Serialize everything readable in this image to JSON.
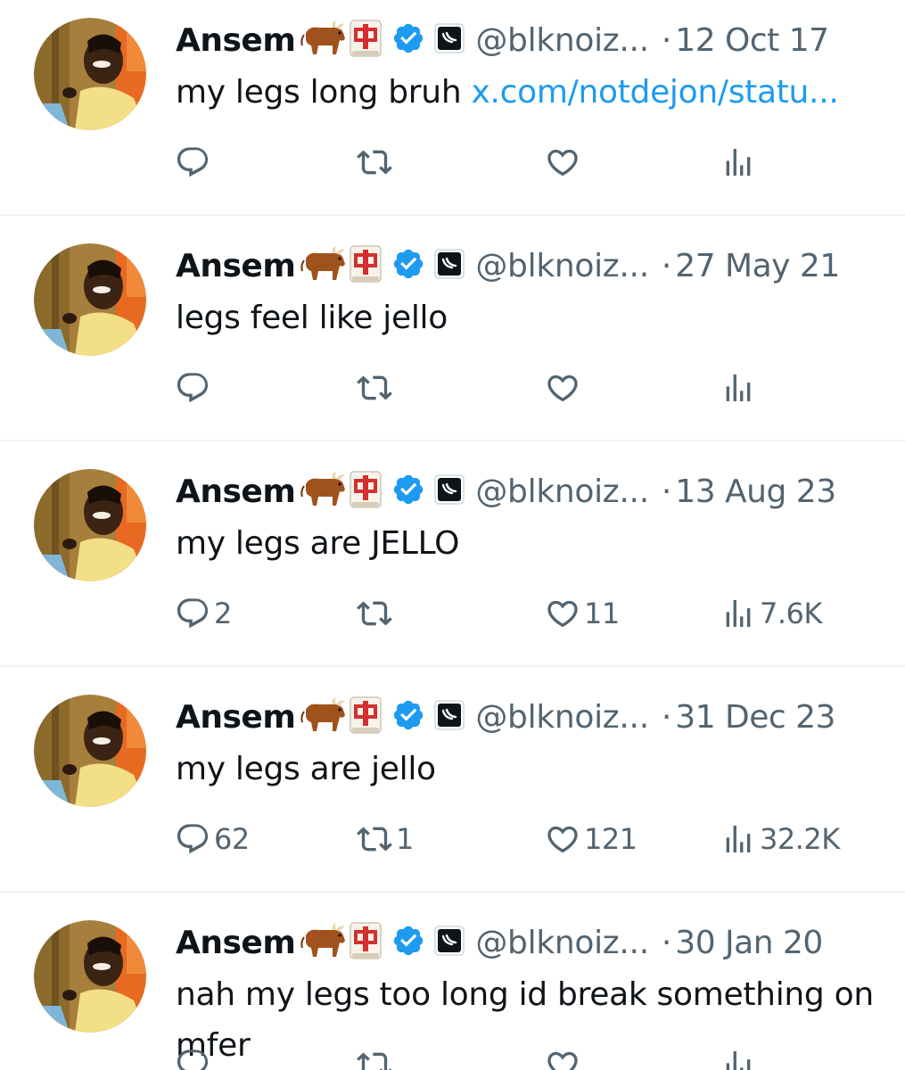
{
  "tweets": [
    {
      "name": "Ansem",
      "handle": "@blknoiz...",
      "dot": "·",
      "date": "12 Oct 17",
      "text": "my legs long bruh ",
      "link": "x.com/notdejon/statu...",
      "text2": "",
      "replies": "",
      "retweets": "",
      "likes": "",
      "views": ""
    },
    {
      "name": "Ansem",
      "handle": "@blknoiz...",
      "dot": "·",
      "date": "27 May 21",
      "text": "legs feel like jello",
      "link": "",
      "text2": "",
      "replies": "",
      "retweets": "",
      "likes": "",
      "views": ""
    },
    {
      "name": "Ansem",
      "handle": "@blknoiz...",
      "dot": "·",
      "date": "13 Aug 23",
      "text": "my legs are JELLO",
      "link": "",
      "text2": "",
      "replies": "2",
      "retweets": "",
      "likes": "11",
      "views": "7.6K"
    },
    {
      "name": "Ansem",
      "handle": "@blknoiz...",
      "dot": "·",
      "date": "31 Dec 23",
      "text": "my legs are jello",
      "link": "",
      "text2": "",
      "replies": "62",
      "retweets": "1",
      "likes": "121",
      "views": "32.2K"
    },
    {
      "name": "Ansem",
      "handle": "@blknoiz...",
      "dot": "·",
      "date": "30 Jan 20",
      "text": "nah my legs too long id break something on",
      "link": "",
      "text2": "mfer",
      "replies": "",
      "retweets": "",
      "likes": "",
      "views": ""
    }
  ],
  "icons": {
    "emoji1": "ox-emoji",
    "emoji2": "mahjong-red-dragon-emoji",
    "verified": "verified-badge-icon",
    "affiliate": "affiliate-badge-icon",
    "reply": "reply-icon",
    "retweet": "retweet-icon",
    "like": "heart-icon",
    "views": "views-icon"
  },
  "colors": {
    "verified": "#1d9bf0",
    "link": "#1d9bf0",
    "secondary_text": "#536471",
    "primary_text": "#0f1419",
    "divider": "#eff3f4"
  }
}
